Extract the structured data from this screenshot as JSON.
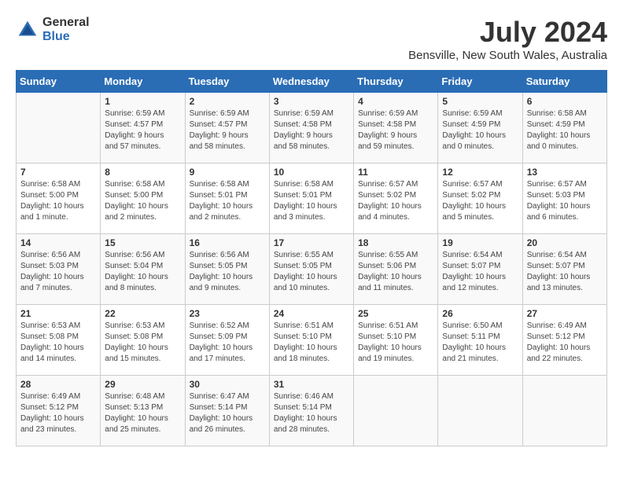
{
  "header": {
    "logo": {
      "general": "General",
      "blue": "Blue"
    },
    "title": "July 2024",
    "location": "Bensville, New South Wales, Australia"
  },
  "calendar": {
    "days_of_week": [
      "Sunday",
      "Monday",
      "Tuesday",
      "Wednesday",
      "Thursday",
      "Friday",
      "Saturday"
    ],
    "weeks": [
      [
        {
          "day": "",
          "info": ""
        },
        {
          "day": "1",
          "info": "Sunrise: 6:59 AM\nSunset: 4:57 PM\nDaylight: 9 hours\nand 57 minutes."
        },
        {
          "day": "2",
          "info": "Sunrise: 6:59 AM\nSunset: 4:57 PM\nDaylight: 9 hours\nand 58 minutes."
        },
        {
          "day": "3",
          "info": "Sunrise: 6:59 AM\nSunset: 4:58 PM\nDaylight: 9 hours\nand 58 minutes."
        },
        {
          "day": "4",
          "info": "Sunrise: 6:59 AM\nSunset: 4:58 PM\nDaylight: 9 hours\nand 59 minutes."
        },
        {
          "day": "5",
          "info": "Sunrise: 6:59 AM\nSunset: 4:59 PM\nDaylight: 10 hours\nand 0 minutes."
        },
        {
          "day": "6",
          "info": "Sunrise: 6:58 AM\nSunset: 4:59 PM\nDaylight: 10 hours\nand 0 minutes."
        }
      ],
      [
        {
          "day": "7",
          "info": "Sunrise: 6:58 AM\nSunset: 5:00 PM\nDaylight: 10 hours\nand 1 minute."
        },
        {
          "day": "8",
          "info": "Sunrise: 6:58 AM\nSunset: 5:00 PM\nDaylight: 10 hours\nand 2 minutes."
        },
        {
          "day": "9",
          "info": "Sunrise: 6:58 AM\nSunset: 5:01 PM\nDaylight: 10 hours\nand 2 minutes."
        },
        {
          "day": "10",
          "info": "Sunrise: 6:58 AM\nSunset: 5:01 PM\nDaylight: 10 hours\nand 3 minutes."
        },
        {
          "day": "11",
          "info": "Sunrise: 6:57 AM\nSunset: 5:02 PM\nDaylight: 10 hours\nand 4 minutes."
        },
        {
          "day": "12",
          "info": "Sunrise: 6:57 AM\nSunset: 5:02 PM\nDaylight: 10 hours\nand 5 minutes."
        },
        {
          "day": "13",
          "info": "Sunrise: 6:57 AM\nSunset: 5:03 PM\nDaylight: 10 hours\nand 6 minutes."
        }
      ],
      [
        {
          "day": "14",
          "info": "Sunrise: 6:56 AM\nSunset: 5:03 PM\nDaylight: 10 hours\nand 7 minutes."
        },
        {
          "day": "15",
          "info": "Sunrise: 6:56 AM\nSunset: 5:04 PM\nDaylight: 10 hours\nand 8 minutes."
        },
        {
          "day": "16",
          "info": "Sunrise: 6:56 AM\nSunset: 5:05 PM\nDaylight: 10 hours\nand 9 minutes."
        },
        {
          "day": "17",
          "info": "Sunrise: 6:55 AM\nSunset: 5:05 PM\nDaylight: 10 hours\nand 10 minutes."
        },
        {
          "day": "18",
          "info": "Sunrise: 6:55 AM\nSunset: 5:06 PM\nDaylight: 10 hours\nand 11 minutes."
        },
        {
          "day": "19",
          "info": "Sunrise: 6:54 AM\nSunset: 5:07 PM\nDaylight: 10 hours\nand 12 minutes."
        },
        {
          "day": "20",
          "info": "Sunrise: 6:54 AM\nSunset: 5:07 PM\nDaylight: 10 hours\nand 13 minutes."
        }
      ],
      [
        {
          "day": "21",
          "info": "Sunrise: 6:53 AM\nSunset: 5:08 PM\nDaylight: 10 hours\nand 14 minutes."
        },
        {
          "day": "22",
          "info": "Sunrise: 6:53 AM\nSunset: 5:08 PM\nDaylight: 10 hours\nand 15 minutes."
        },
        {
          "day": "23",
          "info": "Sunrise: 6:52 AM\nSunset: 5:09 PM\nDaylight: 10 hours\nand 17 minutes."
        },
        {
          "day": "24",
          "info": "Sunrise: 6:51 AM\nSunset: 5:10 PM\nDaylight: 10 hours\nand 18 minutes."
        },
        {
          "day": "25",
          "info": "Sunrise: 6:51 AM\nSunset: 5:10 PM\nDaylight: 10 hours\nand 19 minutes."
        },
        {
          "day": "26",
          "info": "Sunrise: 6:50 AM\nSunset: 5:11 PM\nDaylight: 10 hours\nand 21 minutes."
        },
        {
          "day": "27",
          "info": "Sunrise: 6:49 AM\nSunset: 5:12 PM\nDaylight: 10 hours\nand 22 minutes."
        }
      ],
      [
        {
          "day": "28",
          "info": "Sunrise: 6:49 AM\nSunset: 5:12 PM\nDaylight: 10 hours\nand 23 minutes."
        },
        {
          "day": "29",
          "info": "Sunrise: 6:48 AM\nSunset: 5:13 PM\nDaylight: 10 hours\nand 25 minutes."
        },
        {
          "day": "30",
          "info": "Sunrise: 6:47 AM\nSunset: 5:14 PM\nDaylight: 10 hours\nand 26 minutes."
        },
        {
          "day": "31",
          "info": "Sunrise: 6:46 AM\nSunset: 5:14 PM\nDaylight: 10 hours\nand 28 minutes."
        },
        {
          "day": "",
          "info": ""
        },
        {
          "day": "",
          "info": ""
        },
        {
          "day": "",
          "info": ""
        }
      ]
    ]
  }
}
